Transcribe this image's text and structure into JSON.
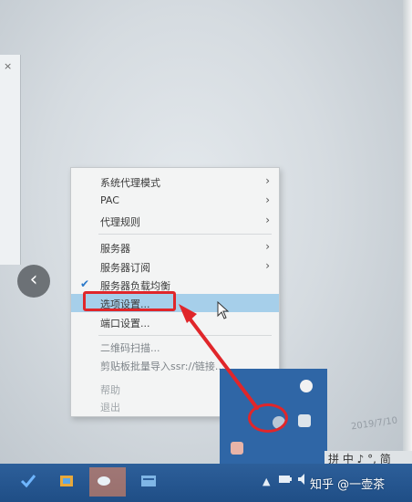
{
  "menu": {
    "items": [
      {
        "label": "系统代理模式",
        "submenu": true
      },
      {
        "label": "PAC",
        "submenu": true
      },
      {
        "label": "代理规则",
        "submenu": true
      },
      {
        "label": "服务器",
        "submenu": true
      },
      {
        "label": "服务器订阅",
        "submenu": true
      },
      {
        "label": "服务器负载均衡",
        "checked": true
      },
      {
        "label": "选项设置...",
        "hover": true
      },
      {
        "label": "端口设置..."
      },
      {
        "label": "二维码扫描..."
      },
      {
        "label": "剪贴板批量导入ssr://链接..."
      },
      {
        "label": "帮助",
        "submenu": true
      },
      {
        "label": "退出"
      }
    ]
  },
  "ime": {
    "text": "拼 中 ♪ °, 简"
  },
  "watermark": "知乎 @一壶茶",
  "clock_faint": "2019/7/10",
  "colors": {
    "annotation_red": "#e0262a",
    "taskbar": "#2d5f9a",
    "hover": "#a6cfea"
  }
}
